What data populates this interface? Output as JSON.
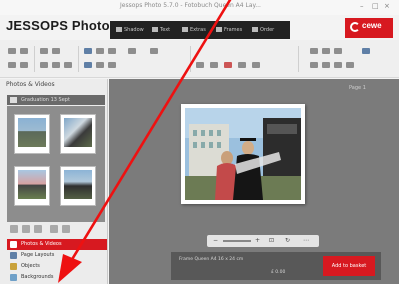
{
  "window": {
    "title": "Jessops Photo 5.7.0 - Fotobuch Queen A4 Lay..."
  },
  "brand": {
    "logo_text": "JESSOPS Photo",
    "partner_logo": "cewe"
  },
  "project_toolbar": {
    "buttons": [
      {
        "label": "Shadow"
      },
      {
        "label": "Text"
      },
      {
        "label": "Extras"
      },
      {
        "label": "Frames"
      },
      {
        "label": "Order"
      }
    ]
  },
  "left_panel": {
    "title": "Photos & Videos",
    "folder_label": "Graduation 13 Sept",
    "navigation": [
      {
        "label": "Photos & Videos",
        "icon": "photo-icon",
        "active": true
      },
      {
        "label": "Page Layouts",
        "icon": "layout-icon",
        "active": false
      },
      {
        "label": "Objects",
        "icon": "object-icon",
        "active": false
      },
      {
        "label": "Backgrounds",
        "icon": "background-icon",
        "active": false
      }
    ]
  },
  "workspace": {
    "page_label": "Page 1",
    "zoom_controls": [
      "zoom-out-icon",
      "zoom-in-icon",
      "fit-icon",
      "rotate-icon"
    ],
    "price_text": "Frame Queen A4 16 x 24 cm",
    "price_value": "£ 0.00",
    "add_to_basket_label": "Add to basket"
  },
  "colors": {
    "accent": "#d71920",
    "workspace_bg": "#7b7b7b",
    "dark_strip": "#222222"
  }
}
